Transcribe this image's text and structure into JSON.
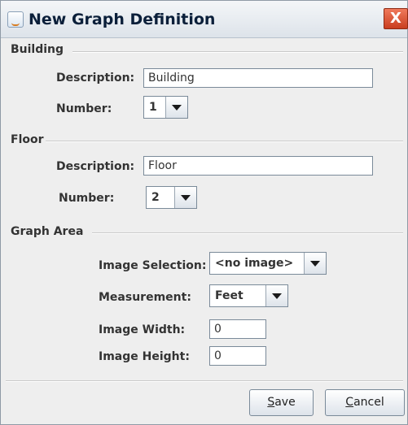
{
  "window": {
    "title": "New Graph Definition",
    "close_glyph": "X"
  },
  "building": {
    "section_label": "Building",
    "description_label": "Description:",
    "description_value": "Building",
    "number_label": "Number:",
    "number_value": "1"
  },
  "floor": {
    "section_label": "Floor",
    "description_label": "Description:",
    "description_value": "Floor",
    "number_label": "Number:",
    "number_value": "2"
  },
  "graph_area": {
    "section_label": "Graph Area",
    "image_selection_label": "Image Selection:",
    "image_selection_value": "<no image>",
    "measurement_label": "Measurement:",
    "measurement_value": "Feet",
    "image_width_label": "Image Width:",
    "image_width_value": "0",
    "image_height_label": "Image Height:",
    "image_height_value": "0"
  },
  "buttons": {
    "save_first": "S",
    "save_rest": "ave",
    "cancel_first": "C",
    "cancel_rest": "ancel"
  },
  "colors": {
    "close_button": "#c93d1f",
    "title_text": "#0b1f3a",
    "label_text": "#333333"
  }
}
